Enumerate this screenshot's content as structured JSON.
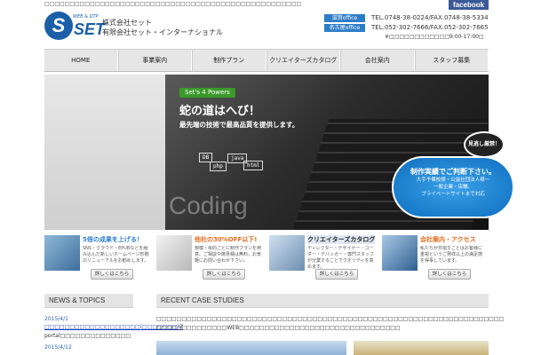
{
  "top": {
    "tagline": "□□□□□□□□□□□□□□□□□□□□□□□□□□□□□□□□□□□□□□□□□□□□□□□□□□□",
    "facebook": "facebook"
  },
  "logo": {
    "sub": "WEB & DTP",
    "mark": "S",
    "set": "SET",
    "company1": "株式会社セット",
    "company2": "有限会社セット・インターナショナル"
  },
  "contact": {
    "offices": [
      {
        "label": "滋賀office",
        "tel": "TEL.0748-38-0224/FAX.0748-38-5334"
      },
      {
        "label": "名古屋office",
        "tel": "TEL.052-302-7666/FAX.052-302-7665"
      }
    ],
    "hours": "※□□□□□□□□□□□□9:00-17:00□"
  },
  "nav": [
    "HOME",
    "事業案内",
    "制作プラン",
    "クリエイターズカタログ",
    "会社案内",
    "スタッフ募集"
  ],
  "hero": {
    "powers": "Set's 4 Powers",
    "headline": "蛇の道はへび！",
    "subline": "最先端の技術で最高品質を提供します。",
    "tags": [
      "DB",
      "php",
      "java",
      "html"
    ],
    "coding": "Coding",
    "badge": "見逃し厳禁！",
    "cloud_title": "制作実績でご判断下さい。",
    "cloud_lines": [
      "大手予備校様・公益社団法人様～",
      "一般企業・店舗、",
      "プライベートサイトまで対応"
    ]
  },
  "features": [
    {
      "title": "5倍の成果を上げる！",
      "text": "SNS・クラウド・EPUBなどを組み込んだ新しいホームページ形態のリニューアルをお勧めします。",
      "button": "詳しくはこちら"
    },
    {
      "title": "他社の30%OFF以下!",
      "text": "規模・目的ごとに制作プランを用意。ご相談や御見積は無料。お気軽にお問い合わせ下さい。",
      "button": "詳しくはこちら"
    },
    {
      "title": "クリエイターズカタログ",
      "text": "ディレクター・デザイナー・コーダー・デバッガー・専門スタッフが分業することでクオリティを高めます。",
      "button": "詳しくはこちら"
    },
    {
      "title": "会社案内・アクセス",
      "text": "私たちが日指すことはお客様に重視というご発祥以上の満足感を得事しています。",
      "button": "詳しくはこちら"
    }
  ],
  "news": {
    "title": "NEWS & TOPICS",
    "items": [
      {
        "date": "2015/4/1",
        "link": "□□□□□□□□□□□□□□□□□□□(□□□□□□□)",
        "extra": "Z",
        "more": "portal□□□□□□□□□□□□□□"
      },
      {
        "date": "2015/4/12",
        "link": "",
        "extra": "",
        "more": ""
      }
    ]
  },
  "cases": {
    "title": "RECENT CASE STUDIES",
    "line1": "□□□□□□□□□□□□□□□□□□□□□□□□□□□□□□□□□□□□□□□□□□□□□□□□□□□□□□□□□□□□□□□□□□□□□",
    "line2": "□□□□□□□□□□□□□□WEB□□□□□□□□□□□□□□□□□□□□□□□□□□□□□□□□"
  }
}
